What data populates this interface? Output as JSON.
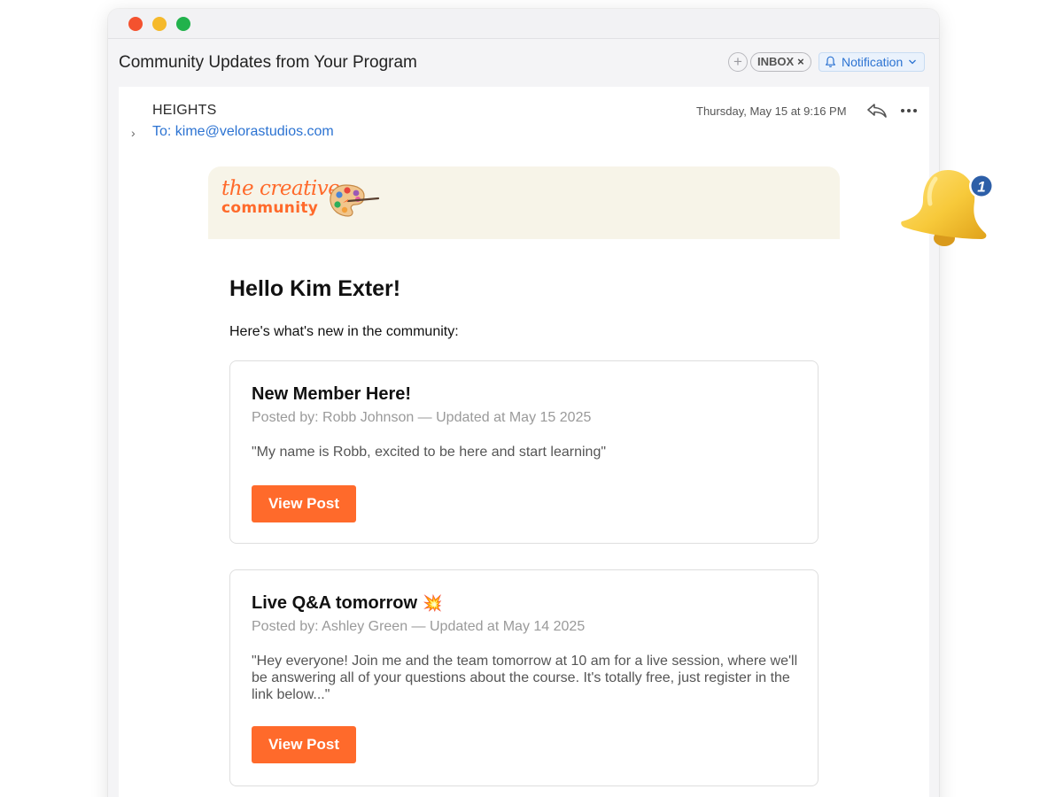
{
  "window": {
    "subject": "Community Updates from Your Program"
  },
  "toolbar": {
    "add_tag_symbol": "+",
    "inbox_label": "INBOX",
    "inbox_remove_symbol": "×",
    "notification_label": "Notification"
  },
  "message": {
    "sender": "HEIGHTS",
    "to": "To: kime@velorastudios.com",
    "date": "Thursday, May 15 at 9:16 PM",
    "expand_symbol": "›"
  },
  "logo": {
    "line1": "the creative",
    "line2": "community"
  },
  "email": {
    "greeting": "Hello Kim Exter!",
    "intro": "Here's what's new in the community:",
    "posts": [
      {
        "title": "New Member Here!",
        "meta": "Posted by: Robb Johnson — Updated at May 15 2025",
        "quote": "\"My name is Robb, excited to be here and start learning\"",
        "button": "View Post"
      },
      {
        "title": "Live Q&A tomorrow",
        "title_emoji": "💥",
        "meta": "Posted by: Ashley Green — Updated at May 14 2025",
        "quote": "\"Hey everyone! Join me and the team tomorrow at 10 am for a live session, where we'll be answering all of your questions about the course. It's totally free, just register in the link below...\"",
        "button": "View Post"
      }
    ]
  },
  "notification_badge": {
    "count": "1"
  },
  "colors": {
    "accent_orange": "#ff6a2b",
    "link_blue": "#2c73d2",
    "bell_yellow": "#f7c93a",
    "badge_blue": "#2d5fa8"
  },
  "icons": [
    "add-icon",
    "close-icon",
    "bell-icon",
    "chevron-down-icon",
    "chevron-right-icon",
    "reply-icon",
    "more-icon",
    "palette-icon",
    "explosion-emoji"
  ]
}
